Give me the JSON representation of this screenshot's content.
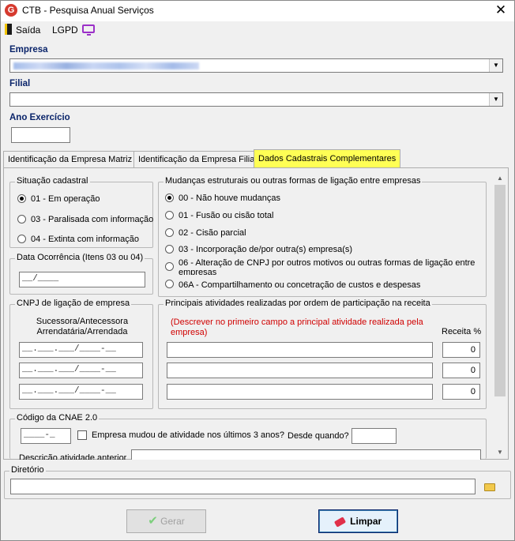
{
  "window": {
    "title": "CTB - Pesquisa Anual Serviços",
    "app_icon_letter": "G",
    "close_label": "✕"
  },
  "toolbar": {
    "saida_label": "Saída",
    "lgpd_label": "LGPD"
  },
  "empresa": {
    "label": "Empresa",
    "value": ""
  },
  "filial": {
    "label": "Filial",
    "value": ""
  },
  "ano_exercicio": {
    "label": "Ano Exercício",
    "value": ""
  },
  "tabs": [
    {
      "label": "Identificação da Empresa Matriz",
      "active": false
    },
    {
      "label": "Identificação da Empresa Filial",
      "active": false
    },
    {
      "label": "Dados Cadastrais Complementares",
      "active": true
    }
  ],
  "situacao": {
    "title": "Situação cadastral",
    "options": [
      {
        "label": "01 - Em operação",
        "selected": true
      },
      {
        "label": "03 - Paralisada com informação",
        "selected": false
      },
      {
        "label": "04 - Extinta com informação",
        "selected": false
      }
    ]
  },
  "mudancas": {
    "title": "Mudanças estruturais ou outras formas de ligação entre empresas",
    "options": [
      {
        "label": "00 - Não houve mudanças",
        "selected": true
      },
      {
        "label": "01 - Fusão ou cisão total",
        "selected": false
      },
      {
        "label": "02 - Cisão parcial",
        "selected": false
      },
      {
        "label": "03 - Incorporação de/por outra(s) empresa(s)",
        "selected": false
      },
      {
        "label": "06 - Alteração de CNPJ por outros motivos ou outras formas de ligação entre empresas",
        "selected": false
      },
      {
        "label": "06A - Compartilhamento ou concetração de custos e despesas",
        "selected": false
      }
    ]
  },
  "data_ocorrencia": {
    "title": "Data Ocorrência (Itens 03 ou 04)",
    "value": "__/____"
  },
  "cnpj_ligacao": {
    "title": "CNPJ de ligação de empresa",
    "subtitle": "Sucessora/Antecessora Arrendatária/Arrendada",
    "values": [
      "__.___.___/____-__",
      "__.___.___/____-__",
      "__.___.___/____-__"
    ]
  },
  "atividades": {
    "title": "Principais atividades realizadas por ordem de participação na receita",
    "instruction": "(Descrever no primeiro campo a principal atividade realizada pela empresa)",
    "receita_header": "Receita %",
    "rows": [
      {
        "descricao": "",
        "receita": "0"
      },
      {
        "descricao": "",
        "receita": "0"
      },
      {
        "descricao": "",
        "receita": "0"
      }
    ]
  },
  "cnae": {
    "title": "Código da CNAE 2.0",
    "code_value": "____-_",
    "mudou_label": "Empresa mudou de atividade nos últimos 3 anos?",
    "mudou_checked": false,
    "desde_label": "Desde quando?",
    "desde_value": "",
    "descricao_anterior_label": "Descrição atividade anterior",
    "descricao_anterior_value": ""
  },
  "diretorio": {
    "title": "Diretório",
    "value": ""
  },
  "buttons": {
    "gerar_label": "Gerar",
    "limpar_label": "Limpar"
  },
  "colors": {
    "active_tab": "#ffff55",
    "instruction_text": "#d00000",
    "section_label": "#0a246a"
  }
}
